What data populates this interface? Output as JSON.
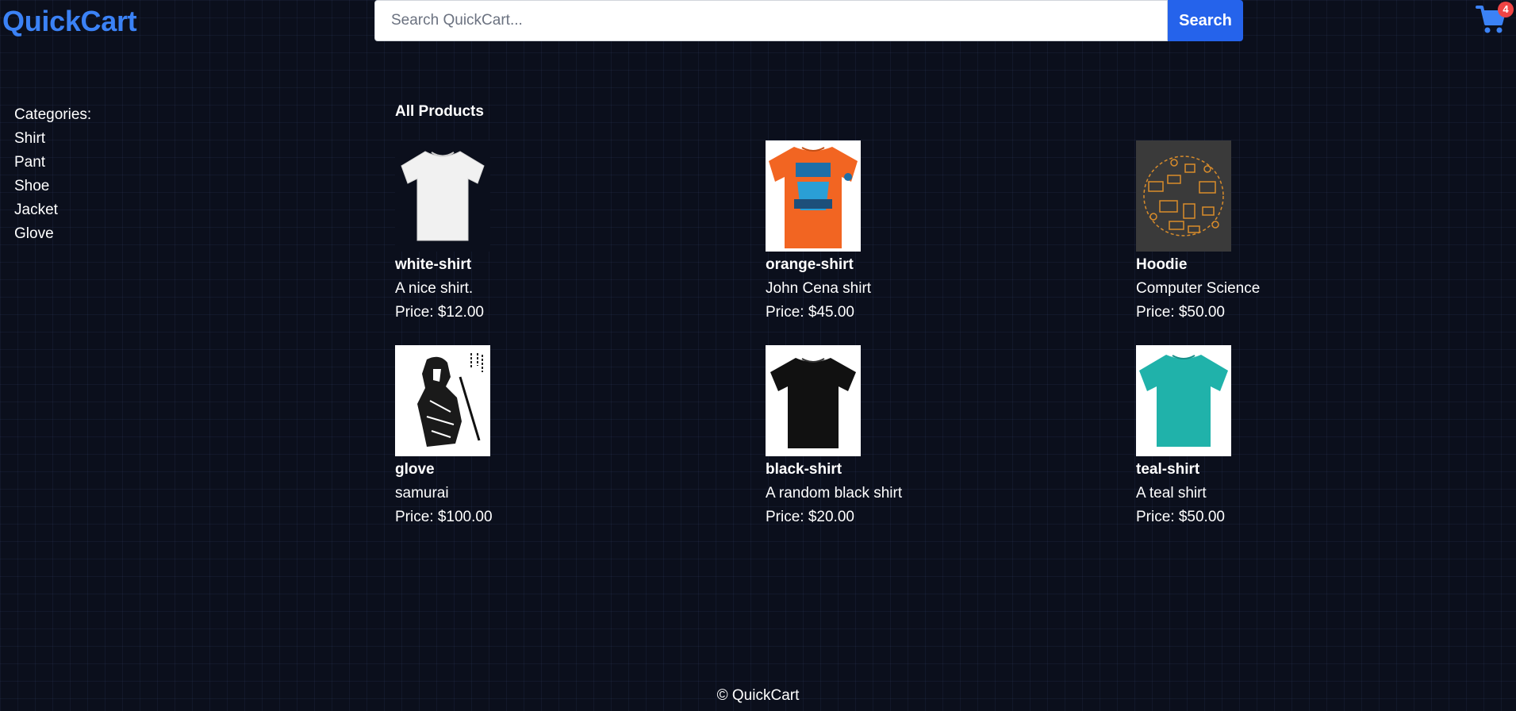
{
  "header": {
    "logo": "QuickCart",
    "search_placeholder": "Search QuickCart...",
    "search_value": "",
    "search_button": "Search",
    "cart_count": "4"
  },
  "sidebar": {
    "heading": "Categories:",
    "items": [
      "Shirt",
      "Pant",
      "Shoe",
      "Jacket",
      "Glove"
    ]
  },
  "main": {
    "title": "All Products",
    "products": [
      {
        "name": "white-shirt",
        "description": "A nice shirt.",
        "price": "Price: $12.00"
      },
      {
        "name": "orange-shirt",
        "description": "John Cena shirt",
        "price": "Price: $45.00"
      },
      {
        "name": "Hoodie",
        "description": "Computer Science",
        "price": "Price: $50.00"
      },
      {
        "name": "glove",
        "description": "samurai",
        "price": "Price: $100.00"
      },
      {
        "name": "black-shirt",
        "description": "A random black shirt",
        "price": "Price: $20.00"
      },
      {
        "name": "teal-shirt",
        "description": "A teal shirt",
        "price": "Price: $50.00"
      }
    ]
  },
  "footer": {
    "text": "© QuickCart"
  },
  "colors": {
    "brand": "#3b82f6",
    "button": "#2563eb",
    "badge": "#ef4444",
    "background": "#0b0f1c"
  }
}
